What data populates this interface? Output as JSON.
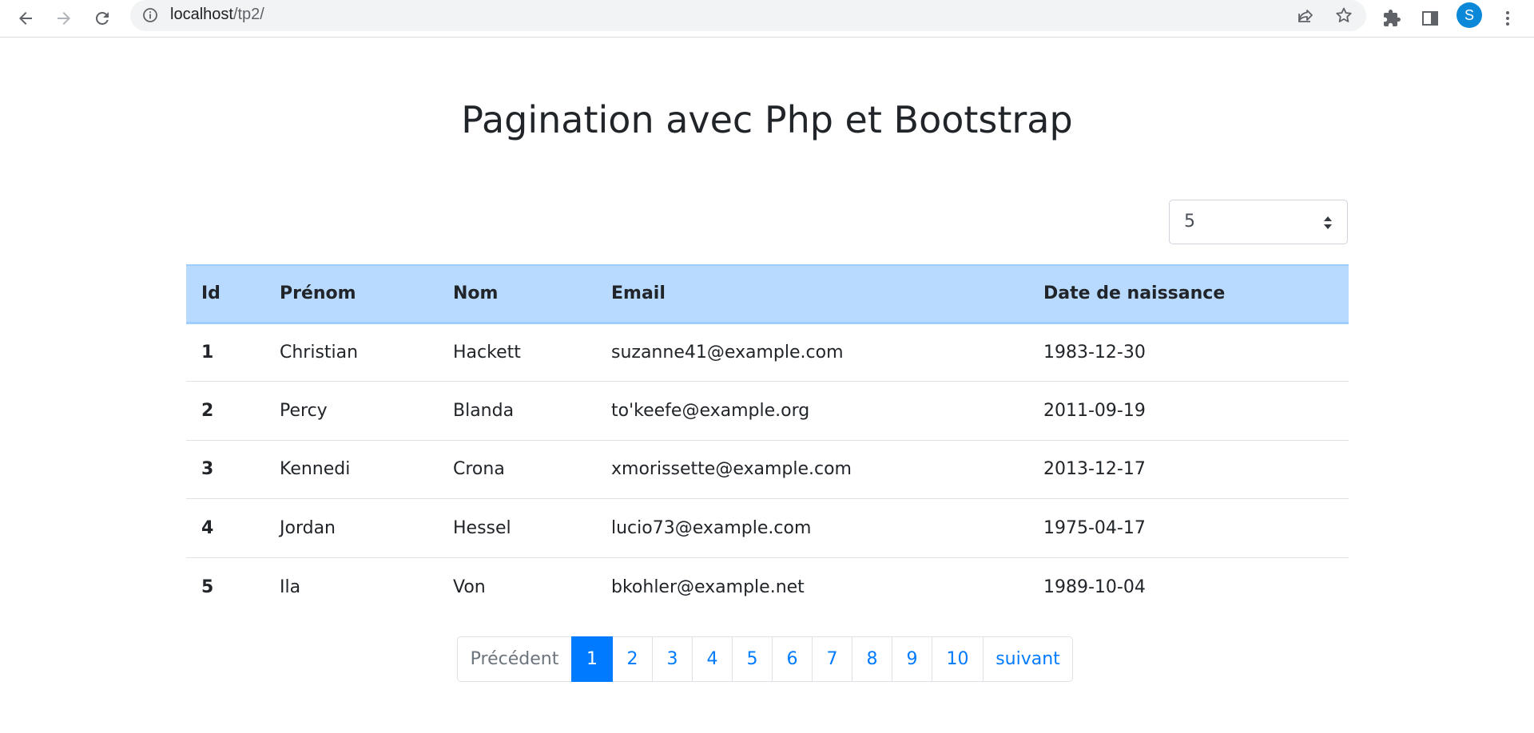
{
  "browser": {
    "url_host": "localhost",
    "url_path": "/tp2/",
    "profile_initial": "S",
    "icons": [
      "back-arrow-icon",
      "forward-arrow-icon",
      "reload-icon",
      "info-icon",
      "share-icon",
      "star-icon",
      "extensions-icon",
      "side-panel-icon",
      "more-vert-icon"
    ]
  },
  "page": {
    "title": "Pagination avec Php et Bootstrap"
  },
  "per_page_select": {
    "value": "5"
  },
  "table": {
    "headers": [
      "Id",
      "Prénom",
      "Nom",
      "Email",
      "Date de naissance"
    ],
    "rows": [
      [
        "1",
        "Christian",
        "Hackett",
        "suzanne41@example.com",
        "1983-12-30"
      ],
      [
        "2",
        "Percy",
        "Blanda",
        "to'keefe@example.org",
        "2011-09-19"
      ],
      [
        "3",
        "Kennedi",
        "Crona",
        "xmorissette@example.com",
        "2013-12-17"
      ],
      [
        "4",
        "Jordan",
        "Hessel",
        "lucio73@example.com",
        "1975-04-17"
      ],
      [
        "5",
        "Ila",
        "Von",
        "bkohler@example.net",
        "1989-10-04"
      ]
    ]
  },
  "pagination": {
    "previous": "Précédent",
    "pages": [
      "1",
      "2",
      "3",
      "4",
      "5",
      "6",
      "7",
      "8",
      "9",
      "10"
    ],
    "active": "1",
    "next": "suivant"
  },
  "colors": {
    "header_bg": "#b8daff",
    "primary": "#007bff",
    "avatar": "#0b88d8"
  }
}
